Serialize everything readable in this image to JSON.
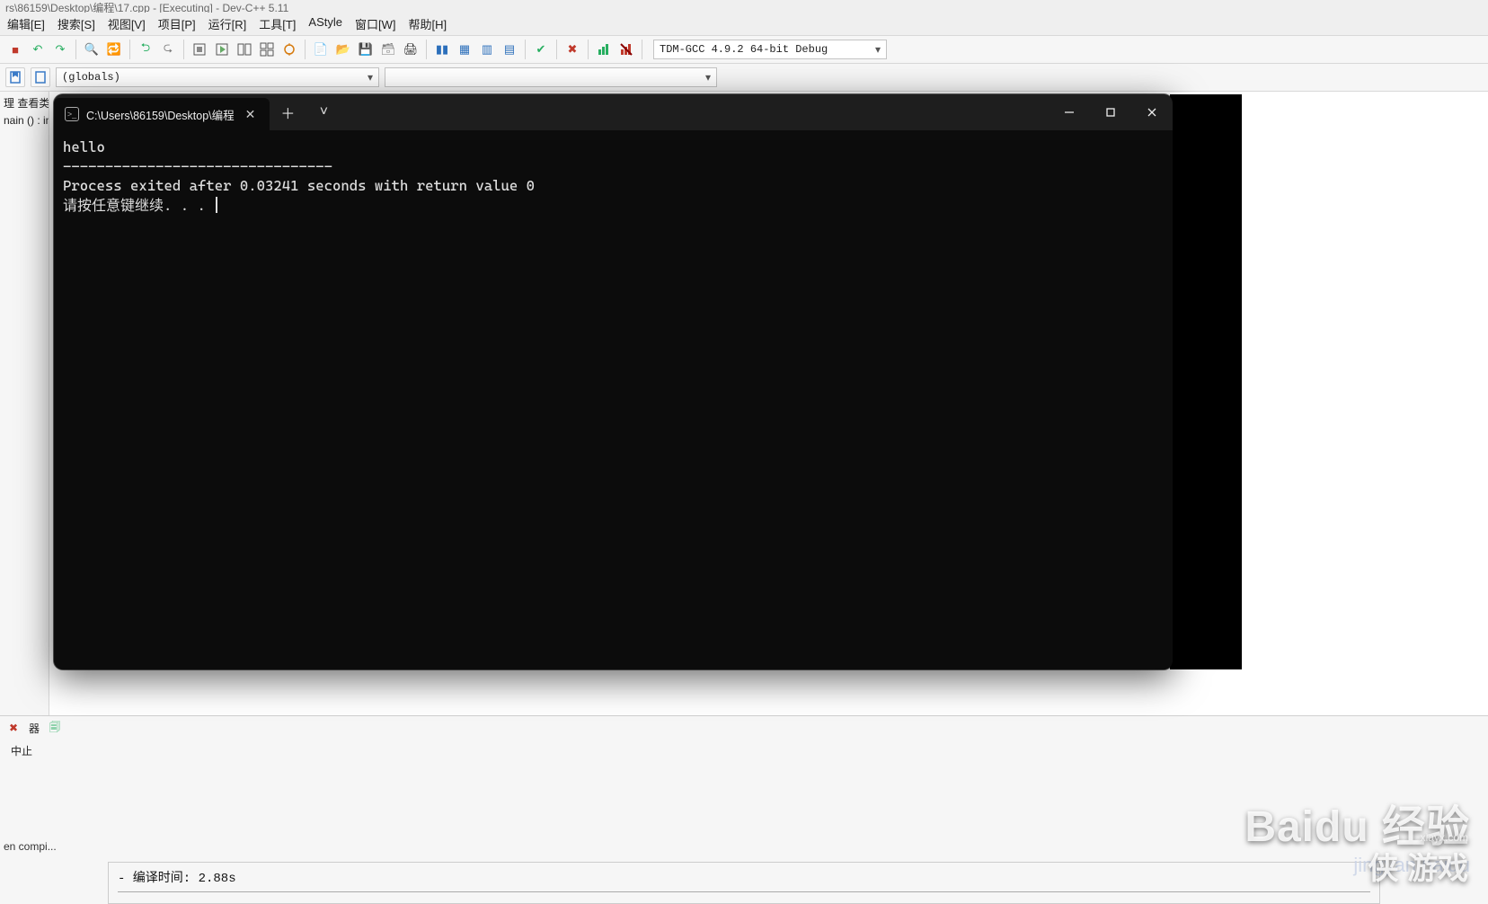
{
  "ide": {
    "title_fragment": "rs\\86159\\Desktop\\编程\\17.cpp - [Executing] - Dev-C++ 5.11",
    "menu": [
      "编辑[E]",
      "搜索[S]",
      "视图[V]",
      "项目[P]",
      "运行[R]",
      "工具[T]",
      "AStyle",
      "窗口[W]",
      "帮助[H]"
    ],
    "compiler": "TDM-GCC 4.9.2 64-bit Debug",
    "globals_selected": "(globals)",
    "members_selected": "",
    "sidebar": {
      "line1": "理  查看类",
      "line2": "nain () : in"
    },
    "bottom": {
      "tab1": "器",
      "tab2": "中止",
      "status": "en compi...",
      "compile_line": "- 编译时间: 2.88s"
    }
  },
  "console": {
    "tab_title": "C:\\Users\\86159\\Desktop\\编程",
    "lines": {
      "l1": "hello",
      "l2": "--------------------------------",
      "l3": "Process exited after 0.03241 seconds with return value 0",
      "l4": "请按任意键继续. . . "
    }
  },
  "watermark": {
    "baidu": "Baidu 经验",
    "baidu_sub": "jingyan.baidu",
    "xia_small": "xiayx.com",
    "xia": "侠 游戏"
  }
}
